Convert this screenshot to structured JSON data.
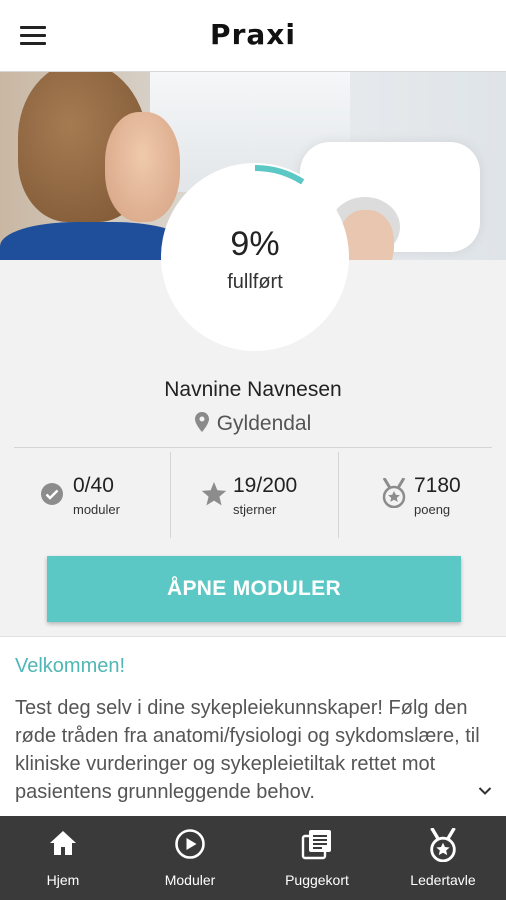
{
  "app": {
    "logo": "Praxi"
  },
  "progress": {
    "percent_text": "9%",
    "label": "fullført",
    "fraction": 0.09
  },
  "profile": {
    "name": "Navnine  Navnesen",
    "location": "Gyldendal"
  },
  "stats": [
    {
      "value": "0/40",
      "label": "moduler",
      "icon": "check-circle-icon"
    },
    {
      "value": "19/200",
      "label": "stjerner",
      "icon": "star-icon"
    },
    {
      "value": "7180",
      "label": "poeng",
      "icon": "medal-icon"
    }
  ],
  "primary_button": {
    "label": "ÅPNE MODULER"
  },
  "welcome": {
    "title": "Velkommen!",
    "body": "Test deg selv i dine sykepleiekunnskaper! Følg den røde tråden fra anatomi/fysiologi og sykdomslære, til kliniske vurderinger og sykepleietiltak rettet mot pasientens grunnleggende behov."
  },
  "bottom_nav": [
    {
      "label": "Hjem",
      "icon": "home-icon"
    },
    {
      "label": "Moduler",
      "icon": "play-circle-icon"
    },
    {
      "label": "Puggekort",
      "icon": "flashcards-icon"
    },
    {
      "label": "Ledertavle",
      "icon": "medal-icon"
    }
  ],
  "colors": {
    "accent": "#5cc8c6",
    "title_teal": "#4fb7b5",
    "nav_bg": "#3a3a3a"
  }
}
